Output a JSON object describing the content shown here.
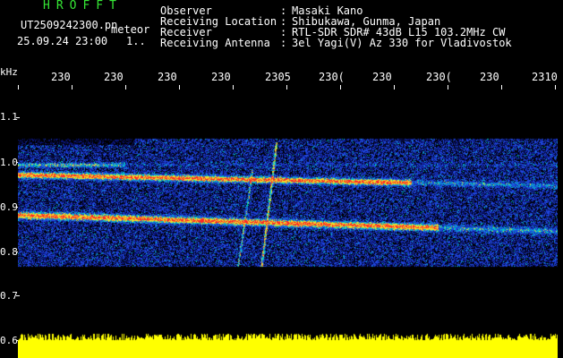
{
  "header": {
    "logo": "HROFFT",
    "file_line": "UT2509242300.pn",
    "date_line": "25.09.24 23:00",
    "page_marker": "1..",
    "mode": "meteor",
    "fields": [
      {
        "label": "Observer",
        "sep": ":",
        "value": "Masaki Kano"
      },
      {
        "label": "Receiving Location",
        "sep": ":",
        "value": "Shibukawa, Gunma, Japan"
      },
      {
        "label": "Receiver",
        "sep": ":",
        "value": "RTL-SDR SDR# 43dB L15 103.2MHz CW"
      },
      {
        "label": "Receiving Antenna",
        "sep": ":",
        "value": "3el Yagi(V) Az 330 for Vladivostok"
      }
    ]
  },
  "axes": {
    "y_unit": "kHz",
    "y_ticks": [
      "1.1",
      "1.0",
      "0.9",
      "0.8",
      "0.7",
      "0.6"
    ],
    "x_ticks": [
      "230",
      "230",
      "230",
      "230",
      "2305",
      "230(",
      "230",
      "230(",
      "230",
      "2310"
    ]
  },
  "colors": {
    "background": "#000000",
    "text": "#ffffff",
    "logo": "#35e635",
    "signal_floor": "#ffff00",
    "noise_low": "#1030c0",
    "noise_mid": "#00d0d0",
    "trace_hot": "#ff2020"
  }
}
